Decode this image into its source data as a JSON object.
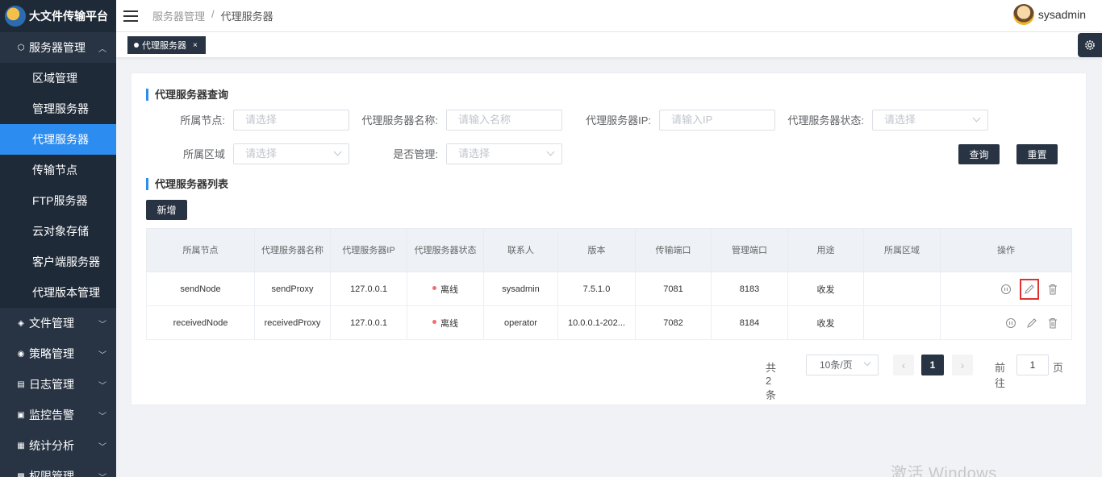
{
  "app": {
    "title": "大文件传输平台"
  },
  "sidebar": {
    "groups": [
      {
        "label": "服务器管理",
        "expanded": true,
        "items": [
          "区域管理",
          "管理服务器",
          "代理服务器",
          "传输节点",
          "FTP服务器",
          "云对象存储",
          "客户端服务器",
          "代理版本管理"
        ],
        "active": "代理服务器"
      },
      {
        "label": "文件管理"
      },
      {
        "label": "策略管理"
      },
      {
        "label": "日志管理"
      },
      {
        "label": "监控告警"
      },
      {
        "label": "统计分析"
      },
      {
        "label": "权限管理"
      }
    ]
  },
  "header": {
    "breadcrumb": [
      "服务器管理",
      "/",
      "代理服务器"
    ],
    "user": "sysadmin"
  },
  "tabs": [
    {
      "label": "代理服务器",
      "close": "×"
    }
  ],
  "query": {
    "title": "代理服务器查询",
    "fields": {
      "node": {
        "label": "所属节点:",
        "placeholder": "请选择"
      },
      "name": {
        "label": "代理服务器名称:",
        "placeholder": "请输入名称"
      },
      "ip": {
        "label": "代理服务器IP:",
        "placeholder": "请输入IP"
      },
      "status": {
        "label": "代理服务器状态:",
        "placeholder": "请选择"
      },
      "region": {
        "label": "所属区域",
        "placeholder": "请选择"
      },
      "managed": {
        "label": "是否管理:",
        "placeholder": "请选择"
      }
    },
    "search_label": "查询",
    "reset_label": "重置"
  },
  "list": {
    "title": "代理服务器列表",
    "add_label": "新增",
    "columns": [
      "所属节点",
      "代理服务器名称",
      "代理服务器IP",
      "代理服务器状态",
      "联系人",
      "版本",
      "传输端口",
      "管理端口",
      "用途",
      "所属区域",
      "操作"
    ],
    "rows": [
      {
        "node": "sendNode",
        "name": "sendProxy",
        "ip": "127.0.0.1",
        "status": "离线",
        "contact": "sysadmin",
        "version": "7.5.1.0",
        "transfer_port": "7081",
        "manage_port": "8183",
        "usage": "收发",
        "region": ""
      },
      {
        "node": "receivedNode",
        "name": "receivedProxy",
        "ip": "127.0.0.1",
        "status": "离线",
        "contact": "operator",
        "version": "10.0.0.1-202...",
        "transfer_port": "7082",
        "manage_port": "8184",
        "usage": "收发",
        "region": ""
      }
    ],
    "status_color": "#f56c6c"
  },
  "pagination": {
    "total": "共 2 条",
    "page_size": "10条/页",
    "prev": "‹",
    "current": "1",
    "next": "›",
    "goto_label": "前往",
    "goto_value": "1",
    "page_label": "页"
  },
  "watermark": "激活 Windows",
  "colors": {
    "sidebar_bg": "#283444",
    "active_item": "#2d8cf0",
    "dark_button": "#283444",
    "highlight_box": "#e03131"
  },
  "icons": [
    "hamburger-icon",
    "gear-icon",
    "pause-icon",
    "edit-icon",
    "delete-icon",
    "chevron-down-icon",
    "chevron-up-icon"
  ]
}
